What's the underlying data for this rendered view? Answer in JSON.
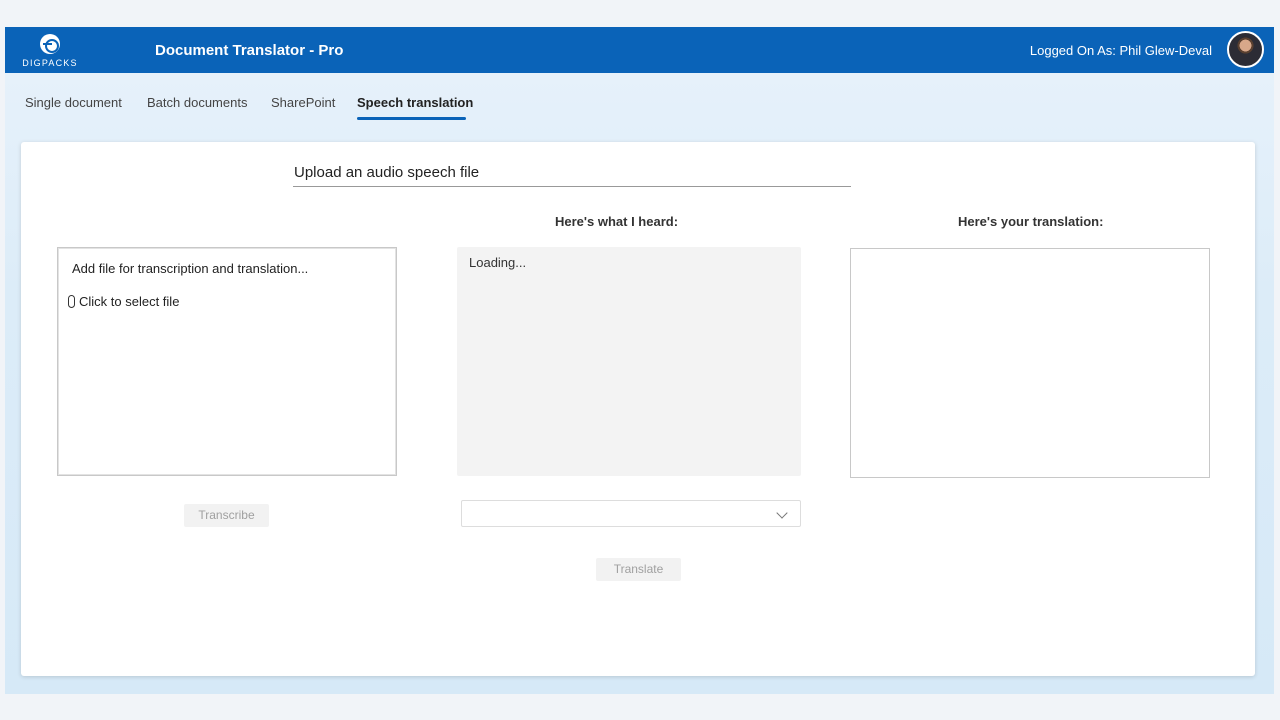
{
  "header": {
    "logo_text": "DIGPACKS",
    "title": "Document Translator - Pro",
    "user_label": "Logged On As: Phil Glew-Deval"
  },
  "tabs": [
    {
      "label": "Single document",
      "active": false
    },
    {
      "label": "Batch documents",
      "active": false
    },
    {
      "label": "SharePoint",
      "active": false
    },
    {
      "label": "Speech translation",
      "active": true
    }
  ],
  "main": {
    "upload_title": "Upload an audio speech file",
    "heard_heading": "Here's what I heard:",
    "translation_heading": "Here's your translation:",
    "file_hint": "Add file for transcription and translation...",
    "select_file_label": "Click to select file",
    "heard_text": "Loading...",
    "translation_text": "",
    "transcribe_label": "Transcribe",
    "language_select_value": "",
    "translate_label": "Translate"
  },
  "icons": {
    "paperclip": "paperclip-icon",
    "chevron": "chevron-down-icon"
  },
  "colors": {
    "brand": "#0a63b8",
    "header_text": "#ffffff",
    "disabled_button_bg": "#f2f2f2",
    "disabled_button_text": "#a0a0a0"
  }
}
